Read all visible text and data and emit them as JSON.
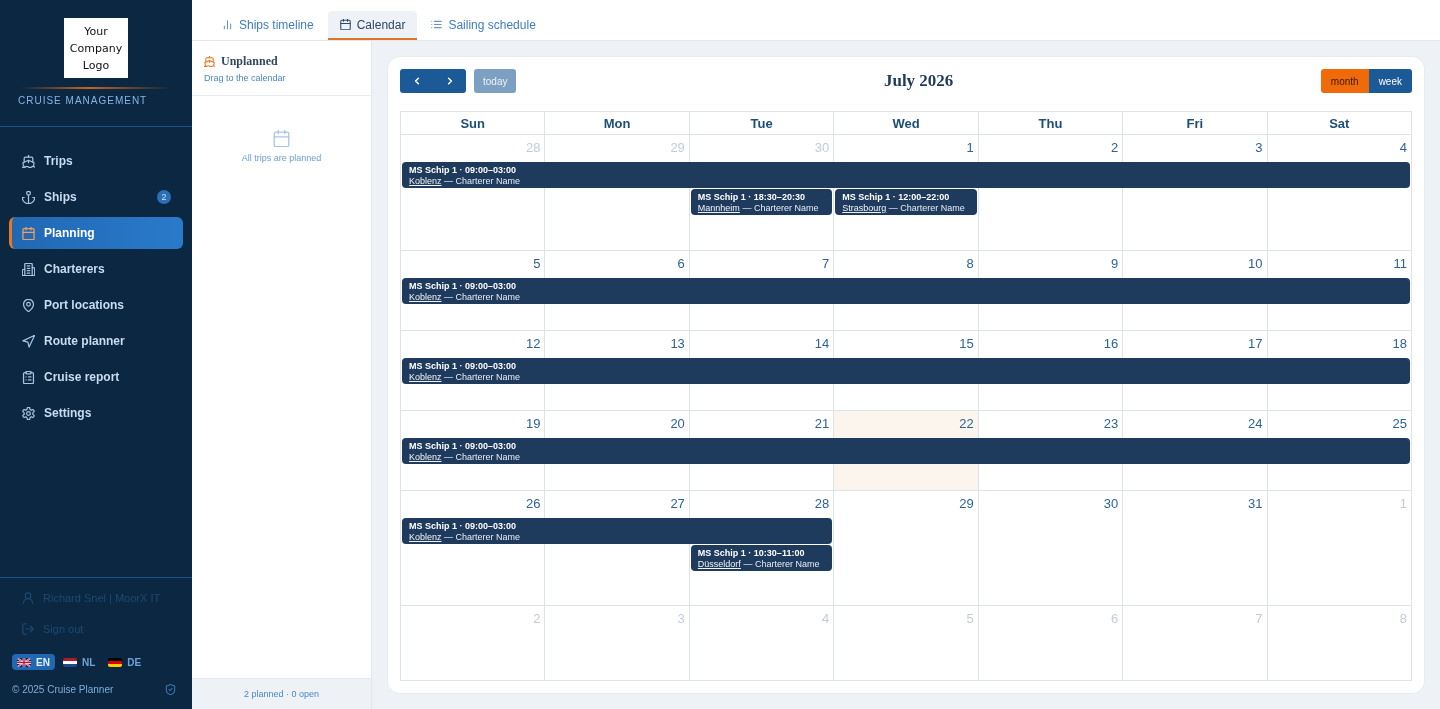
{
  "sidebar": {
    "logo_text": "Your Company Logo",
    "brand": "CRUISE MANAGEMENT",
    "nav": [
      {
        "label": "Trips",
        "selected": false
      },
      {
        "label": "Ships",
        "badge": "2",
        "selected": false
      },
      {
        "label": "Planning",
        "selected": true
      },
      {
        "label": "Charterers",
        "selected": false
      },
      {
        "label": "Port locations",
        "selected": false
      },
      {
        "label": "Route planner",
        "selected": false
      },
      {
        "label": "Cruise report",
        "selected": false
      },
      {
        "label": "Settings",
        "selected": false
      }
    ],
    "user": "Richard Snel | MoorX IT",
    "sign_out": "Sign out",
    "languages": [
      {
        "code": "EN",
        "selected": true
      },
      {
        "code": "NL",
        "selected": false
      },
      {
        "code": "DE",
        "selected": false
      }
    ],
    "copyright": "© 2025 Cruise Planner"
  },
  "tabs": [
    {
      "label": "Ships timeline",
      "selected": false
    },
    {
      "label": "Calendar",
      "selected": true
    },
    {
      "label": "Sailing schedule",
      "selected": false
    }
  ],
  "unplanned": {
    "title": "Unplanned",
    "subtitle": "Drag to the calendar",
    "empty_text": "All trips are planned",
    "footer": "2 planned · 0 open"
  },
  "calendar": {
    "today_button": {
      "label": "today",
      "disabled": true
    },
    "title": "July 2026",
    "views": [
      {
        "label": "month",
        "selected": true
      },
      {
        "label": "week",
        "selected": false
      }
    ],
    "weekdays": [
      "Sun",
      "Mon",
      "Tue",
      "Wed",
      "Thu",
      "Fri",
      "Sat"
    ],
    "weeks": [
      {
        "days": [
          {
            "number": "28",
            "other_month": true,
            "today": false
          },
          {
            "number": "29",
            "other_month": true,
            "today": false
          },
          {
            "number": "30",
            "other_month": true,
            "today": false
          },
          {
            "number": "1",
            "other_month": false,
            "today": false
          },
          {
            "number": "2",
            "other_month": false,
            "today": false
          },
          {
            "number": "3",
            "other_month": false,
            "today": false
          },
          {
            "number": "4",
            "other_month": false,
            "today": false
          }
        ],
        "lanes": [
          {
            "slots": [
              {
                "kind": "event",
                "title": "MS Schip 1 · 09:00–03:00",
                "place": "Koblenz",
                "charterer_text": "— Charterer Name"
              },
              {
                "kind": "continued"
              },
              {
                "kind": "continued"
              },
              {
                "kind": "continued"
              },
              {
                "kind": "continued"
              },
              {
                "kind": "continued"
              },
              {
                "kind": "continued"
              }
            ]
          },
          {
            "slots": [
              {
                "kind": "empty"
              },
              {
                "kind": "empty"
              },
              {
                "kind": "event",
                "title": "MS Schip 1 · 18:30–20:30",
                "place": "Mannheim",
                "charterer_text": "— Charterer Name"
              },
              {
                "kind": "event",
                "title": "MS Schip 1 · 12:00–22:00",
                "place": "Strasbourg",
                "charterer_text": "— Charterer Name"
              },
              {
                "kind": "empty"
              },
              {
                "kind": "empty"
              },
              {
                "kind": "empty"
              }
            ]
          }
        ]
      },
      {
        "days": [
          {
            "number": "5",
            "other_month": false,
            "today": false
          },
          {
            "number": "6",
            "other_month": false,
            "today": false
          },
          {
            "number": "7",
            "other_month": false,
            "today": false
          },
          {
            "number": "8",
            "other_month": false,
            "today": false
          },
          {
            "number": "9",
            "other_month": false,
            "today": false
          },
          {
            "number": "10",
            "other_month": false,
            "today": false
          },
          {
            "number": "11",
            "other_month": false,
            "today": false
          }
        ],
        "lanes": [
          {
            "slots": [
              {
                "kind": "event",
                "title": "MS Schip 1 · 09:00–03:00",
                "place": "Koblenz",
                "charterer_text": "— Charterer Name"
              },
              {
                "kind": "continued"
              },
              {
                "kind": "continued"
              },
              {
                "kind": "continued"
              },
              {
                "kind": "continued"
              },
              {
                "kind": "continued"
              },
              {
                "kind": "continued"
              }
            ]
          }
        ]
      },
      {
        "days": [
          {
            "number": "12",
            "other_month": false,
            "today": false
          },
          {
            "number": "13",
            "other_month": false,
            "today": false
          },
          {
            "number": "14",
            "other_month": false,
            "today": false
          },
          {
            "number": "15",
            "other_month": false,
            "today": false
          },
          {
            "number": "16",
            "other_month": false,
            "today": false
          },
          {
            "number": "17",
            "other_month": false,
            "today": false
          },
          {
            "number": "18",
            "other_month": false,
            "today": false
          }
        ],
        "lanes": [
          {
            "slots": [
              {
                "kind": "event",
                "title": "MS Schip 1 · 09:00–03:00",
                "place": "Koblenz",
                "charterer_text": "— Charterer Name"
              },
              {
                "kind": "continued"
              },
              {
                "kind": "continued"
              },
              {
                "kind": "continued"
              },
              {
                "kind": "continued"
              },
              {
                "kind": "continued"
              },
              {
                "kind": "continued"
              }
            ]
          }
        ]
      },
      {
        "days": [
          {
            "number": "19",
            "other_month": false,
            "today": false
          },
          {
            "number": "20",
            "other_month": false,
            "today": false
          },
          {
            "number": "21",
            "other_month": false,
            "today": false
          },
          {
            "number": "22",
            "other_month": false,
            "today": true
          },
          {
            "number": "23",
            "other_month": false,
            "today": false
          },
          {
            "number": "24",
            "other_month": false,
            "today": false
          },
          {
            "number": "25",
            "other_month": false,
            "today": false
          }
        ],
        "lanes": [
          {
            "slots": [
              {
                "kind": "event",
                "title": "MS Schip 1 · 09:00–03:00",
                "place": "Koblenz",
                "charterer_text": "— Charterer Name"
              },
              {
                "kind": "continued"
              },
              {
                "kind": "continued"
              },
              {
                "kind": "continued"
              },
              {
                "kind": "continued"
              },
              {
                "kind": "continued"
              },
              {
                "kind": "continued"
              }
            ]
          }
        ]
      },
      {
        "days": [
          {
            "number": "26",
            "other_month": false,
            "today": false
          },
          {
            "number": "27",
            "other_month": false,
            "today": false
          },
          {
            "number": "28",
            "other_month": false,
            "today": false
          },
          {
            "number": "29",
            "other_month": false,
            "today": false
          },
          {
            "number": "30",
            "other_month": false,
            "today": false
          },
          {
            "number": "31",
            "other_month": false,
            "today": false
          },
          {
            "number": "1",
            "other_month": true,
            "today": false
          }
        ],
        "lanes": [
          {
            "slots": [
              {
                "kind": "event",
                "title": "MS Schip 1 · 09:00–03:00",
                "place": "Koblenz",
                "charterer_text": "— Charterer Name"
              },
              {
                "kind": "continued"
              },
              {
                "kind": "continued"
              },
              {
                "kind": "empty"
              },
              {
                "kind": "empty"
              },
              {
                "kind": "empty"
              },
              {
                "kind": "empty"
              }
            ]
          },
          {
            "slots": [
              {
                "kind": "empty"
              },
              {
                "kind": "empty"
              },
              {
                "kind": "event",
                "title": "MS Schip 1 · 10:30–11:00",
                "place": "Düsseldorf",
                "charterer_text": "— Charterer Name"
              },
              {
                "kind": "empty"
              },
              {
                "kind": "empty"
              },
              {
                "kind": "empty"
              },
              {
                "kind": "empty"
              }
            ]
          }
        ]
      },
      {
        "days": [
          {
            "number": "2",
            "other_month": true,
            "today": false
          },
          {
            "number": "3",
            "other_month": true,
            "today": false
          },
          {
            "number": "4",
            "other_month": true,
            "today": false
          },
          {
            "number": "5",
            "other_month": true,
            "today": false
          },
          {
            "number": "6",
            "other_month": true,
            "today": false
          },
          {
            "number": "7",
            "other_month": true,
            "today": false
          },
          {
            "number": "8",
            "other_month": true,
            "today": false
          }
        ]
      }
    ]
  }
}
